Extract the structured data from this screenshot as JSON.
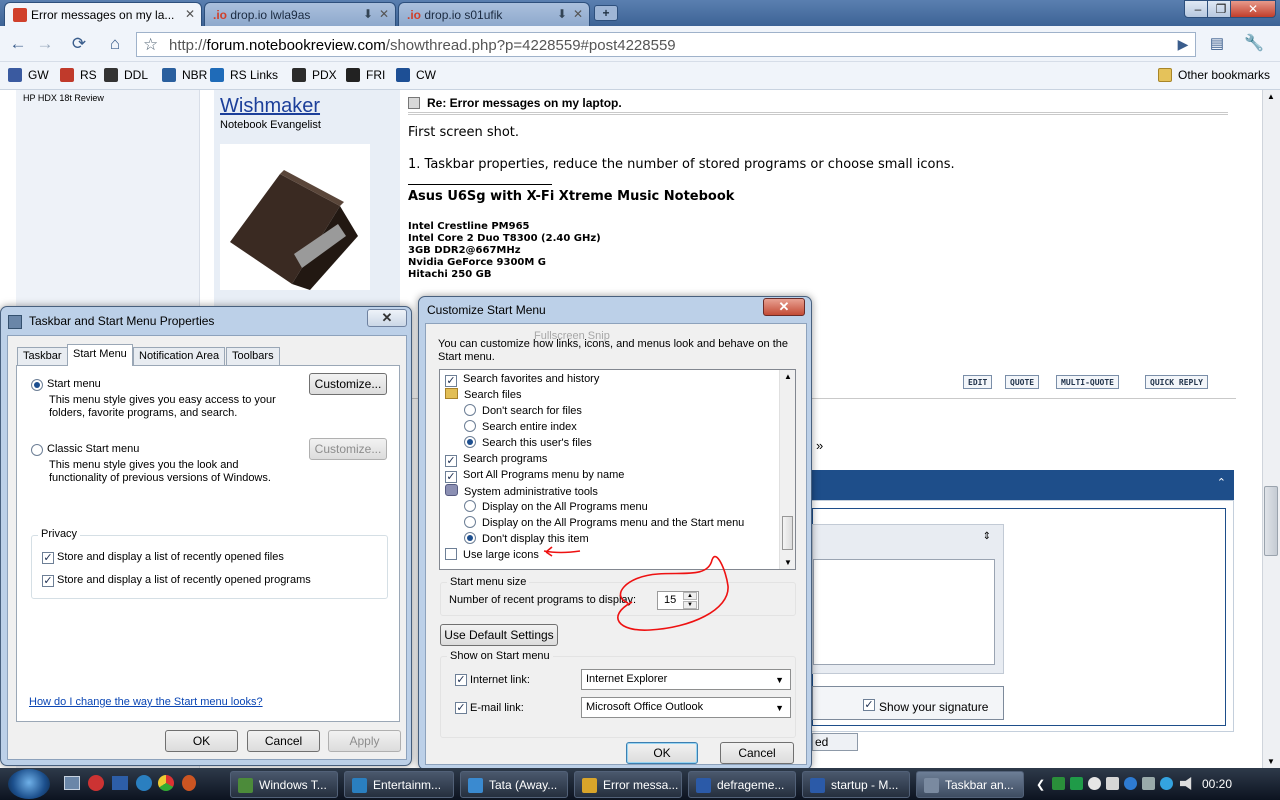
{
  "browser": {
    "tabs": [
      {
        "label": "Error messages on my la...",
        "active": true
      },
      {
        "label": "drop.io lwla9as",
        "prefix": ".io",
        "active": false
      },
      {
        "label": "drop.io s01ufik",
        "prefix": ".io",
        "active": false
      }
    ],
    "new_tab": "+",
    "window_controls": {
      "minimize": "–",
      "maximize": "❐",
      "close": "✕"
    },
    "url_scheme": "http://",
    "url_host": "forum.notebookreview.com",
    "url_path": "/showthread.php?p=4228559#post4228559",
    "bookmarks": [
      {
        "label": "GW",
        "color": "#3a5aa0"
      },
      {
        "label": "RS",
        "color": "#c03a2b"
      },
      {
        "label": "DDL",
        "color": "#333333"
      },
      {
        "label": "NBR",
        "color": "#2a5f9e"
      },
      {
        "label": "RS Links",
        "color": "#1f6bb8"
      },
      {
        "label": "PDX",
        "color": "#2b2b2b"
      },
      {
        "label": "FRI",
        "color": "#222222"
      },
      {
        "label": "CW",
        "color": "#1d4f95"
      }
    ],
    "other_bookmarks": "Other bookmarks"
  },
  "forum": {
    "sidebar_link": "HP HDX 18t Review",
    "author": "Wishmaker",
    "author_title": "Notebook Evangelist",
    "post_title": "Re: Error messages on my laptop.",
    "post_lines": [
      "First screen shot.",
      "1. Taskbar properties, reduce the number of stored programs or choose small icons."
    ],
    "signature_title": "Asus U6Sg with X-Fi Xtreme Music Notebook",
    "signature_specs": [
      "Intel Crestline PM965",
      "Intel Core 2 Duo T8300 (2.40 GHz)",
      "3GB DDR2@667MHz",
      "Nvidia GeForce 9300M G",
      "Hitachi 250 GB"
    ],
    "post_buttons": [
      "EDIT",
      "QUOTE",
      "MULTI-QUOTE",
      "QUICK REPLY"
    ],
    "show_signature": "Show your signature",
    "fragment_ed": "ed",
    "fragment_raquo": "»"
  },
  "taskbar_dialog": {
    "title": "Taskbar and Start Menu Properties",
    "tabs": [
      "Taskbar",
      "Start Menu",
      "Notification Area",
      "Toolbars"
    ],
    "active_tab": "Start Menu",
    "start_menu_label": "Start menu",
    "start_menu_desc": "This menu style gives you easy access to your folders, favorite programs, and search.",
    "customize_label": "Customize...",
    "classic_label": "Classic Start menu",
    "classic_desc": "This menu style gives you the look and functionality of previous versions of Windows.",
    "classic_customize": "Customize...",
    "privacy_label": "Privacy",
    "privacy_files": "Store and display a list of recently opened files",
    "privacy_programs": "Store and display a list of recently opened programs",
    "help_link": "How do I change the way the Start menu looks?",
    "ok": "OK",
    "cancel": "Cancel",
    "apply": "Apply"
  },
  "customize_dialog": {
    "title": "Customize Start Menu",
    "intro": "You can customize how links, icons, and menus look and behave on the Start menu.",
    "items": [
      {
        "type": "checkbox",
        "label": "Search favorites and history",
        "checked": true,
        "level": 0
      },
      {
        "type": "folder",
        "label": "Search files",
        "level": 0
      },
      {
        "type": "radio",
        "label": "Don't search for files",
        "checked": false,
        "level": 1
      },
      {
        "type": "radio",
        "label": "Search entire index",
        "checked": false,
        "level": 1
      },
      {
        "type": "radio",
        "label": "Search this user's files",
        "checked": true,
        "level": 1
      },
      {
        "type": "checkbox",
        "label": "Search programs",
        "checked": true,
        "level": 0
      },
      {
        "type": "checkbox",
        "label": "Sort All Programs menu by name",
        "checked": true,
        "level": 0
      },
      {
        "type": "gear",
        "label": "System administrative tools",
        "level": 0
      },
      {
        "type": "radio",
        "label": "Display on the All Programs menu",
        "checked": false,
        "level": 1
      },
      {
        "type": "radio",
        "label": "Display on the All Programs menu and the Start menu",
        "checked": false,
        "level": 1
      },
      {
        "type": "radio",
        "label": "Don't display this item",
        "checked": true,
        "level": 1
      },
      {
        "type": "checkbox",
        "label": "Use large icons",
        "checked": false,
        "level": 0
      }
    ],
    "start_menu_size_label": "Start menu size",
    "recent_programs_label": "Number of recent programs to display:",
    "recent_programs_value": "15",
    "default_settings": "Use Default Settings",
    "show_on_start_label": "Show on Start menu",
    "internet_link_label": "Internet link:",
    "internet_link_value": "Internet Explorer",
    "email_link_label": "E-mail link:",
    "email_link_value": "Microsoft Office Outlook",
    "ok": "OK",
    "cancel": "Cancel",
    "ghost_text": "Fullscreen Snip"
  },
  "taskbar": {
    "buttons": [
      {
        "label": "Windows T...",
        "color": "#4c8b3a"
      },
      {
        "label": "Entertainm...",
        "color": "#2a7fc0"
      },
      {
        "label": "Tata (Away...",
        "color": "#3a8ad0"
      },
      {
        "label": "Error messa...",
        "color": "#d9a52a"
      },
      {
        "label": "defrageme...",
        "color": "#2b5aa8"
      },
      {
        "label": "startup - M...",
        "color": "#2b5aa8"
      },
      {
        "label": "Taskbar an...",
        "color": "#7a8aa0",
        "active": true
      }
    ],
    "clock": "00:20"
  }
}
